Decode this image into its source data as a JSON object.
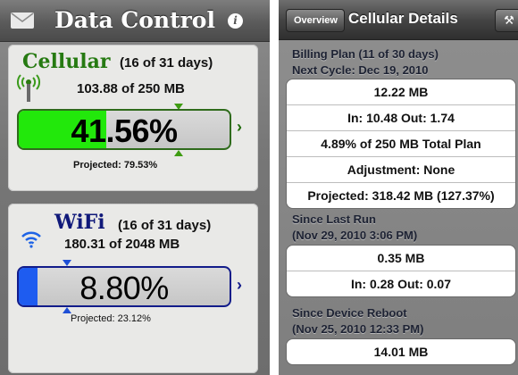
{
  "left": {
    "title": "Data Control",
    "info_label": "i",
    "cellular": {
      "name": "Cellular",
      "days": "(16 of 31 days)",
      "usage": "103.88 of 250 MB",
      "percent": "41.56%",
      "percent_value": 41.56,
      "projected": "Projected: 79.53%",
      "projected_value": 79.53,
      "accent_color": "#22e80b"
    },
    "wifi": {
      "name": "WiFi",
      "days": "(16 of 31 days)",
      "usage": "180.31 of 2048 MB",
      "percent": "8.80%",
      "percent_value": 8.8,
      "projected": "Projected: 23.12%",
      "projected_value": 23.12,
      "accent_color": "#1e5cf0"
    }
  },
  "right": {
    "back_label": "Overview",
    "title": "Cellular Details",
    "tool_icon": "wrench-icon",
    "sections": [
      {
        "header_line1": "Billing Plan (11 of 30 days)",
        "header_line2": "Next Cycle: Dec 19, 2010",
        "rows": [
          "12.22 MB",
          "In: 10.48 Out: 1.74",
          "4.89% of 250 MB Total Plan",
          "Adjustment: None",
          "Projected: 318.42 MB (127.37%)"
        ]
      },
      {
        "header_line1": "Since Last Run",
        "header_line2": "(Nov 29, 2010 3:06 PM)",
        "rows": [
          "0.35 MB",
          "In: 0.28 Out: 0.07"
        ]
      },
      {
        "header_line1": "Since Device Reboot",
        "header_line2": "(Nov 25, 2010 12:33 PM)",
        "rows": [
          "14.01 MB"
        ]
      }
    ]
  }
}
